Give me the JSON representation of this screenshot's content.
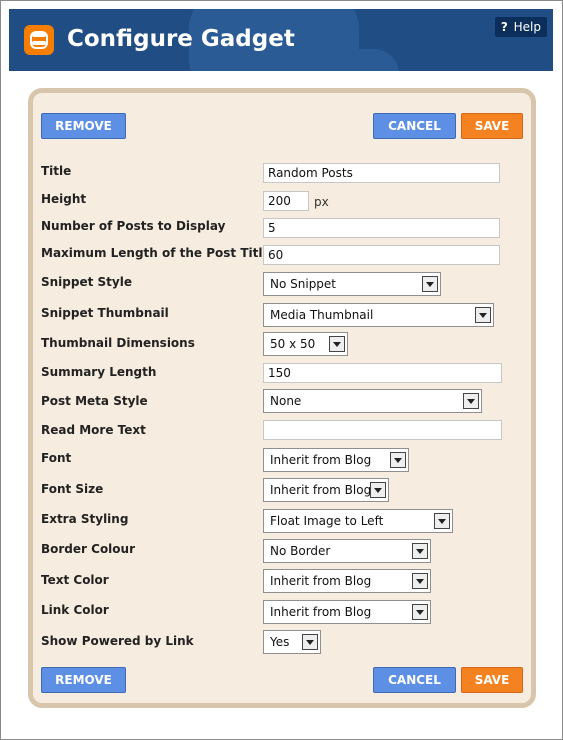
{
  "header": {
    "title": "Configure Gadget",
    "help_label": "Help",
    "help_q": "?"
  },
  "buttons": {
    "remove": "REMOVE",
    "cancel": "CANCEL",
    "save": "SAVE"
  },
  "fields": {
    "title": {
      "label": "Title",
      "value": "Random Posts"
    },
    "height": {
      "label": "Height",
      "value": "200",
      "unit": "px"
    },
    "num_posts": {
      "label": "Number of Posts to Display",
      "value": "5"
    },
    "max_title_len": {
      "label": "Maximum Length of the Post Title",
      "value": "60"
    },
    "snippet_style": {
      "label": "Snippet Style",
      "value": "No Snippet"
    },
    "snippet_thumb": {
      "label": "Snippet Thumbnail",
      "value": "Media Thumbnail"
    },
    "thumb_dims": {
      "label": "Thumbnail Dimensions",
      "value": "50 x 50"
    },
    "summary_len": {
      "label": "Summary Length",
      "value": "150"
    },
    "post_meta": {
      "label": "Post Meta Style",
      "value": "None"
    },
    "read_more": {
      "label": "Read More Text",
      "value": ""
    },
    "font": {
      "label": "Font",
      "value": "Inherit from Blog"
    },
    "font_size": {
      "label": "Font Size",
      "value": "Inherit from Blog"
    },
    "extra_styling": {
      "label": "Extra Styling",
      "value": "Float Image to Left"
    },
    "border_colour": {
      "label": "Border Colour",
      "value": "No Border"
    },
    "text_color": {
      "label": "Text Color",
      "value": "Inherit from Blog"
    },
    "link_color": {
      "label": "Link Color",
      "value": "Inherit from Blog"
    },
    "powered_by": {
      "label": "Show Powered by Link",
      "value": "Yes"
    }
  },
  "colors": {
    "header_bg": "#1f4d84",
    "panel_bg": "#f6ecdf",
    "blue_button": "#5d90e5",
    "orange_button": "#f58220",
    "logo": "#f57d00"
  },
  "icons": {
    "logo": "blogger-logo-icon",
    "dropdown": "dropdown-arrow-icon"
  }
}
